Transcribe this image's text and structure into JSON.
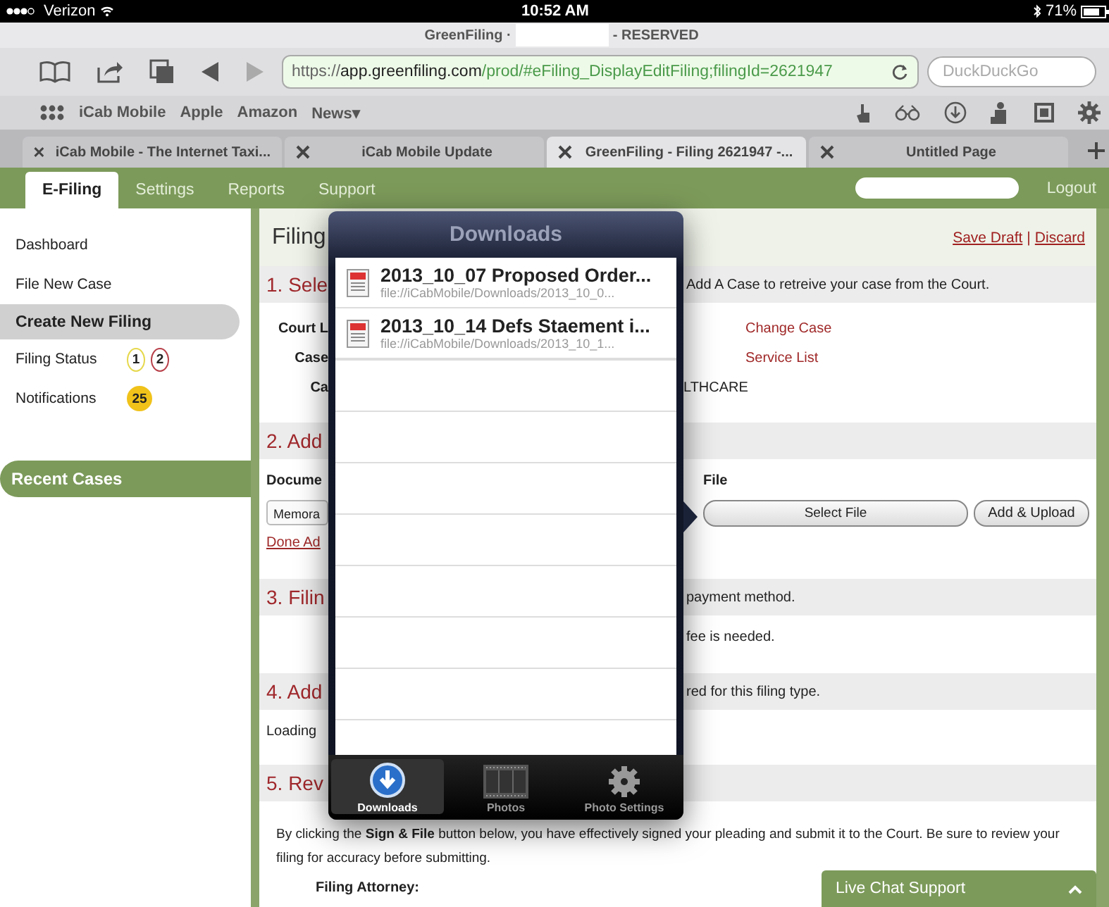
{
  "status_bar": {
    "carrier": "Verizon",
    "time": "10:52 AM",
    "battery": "71%"
  },
  "title_bar": {
    "left": "GreenFiling ·",
    "right": "- RESERVED"
  },
  "toolbar": {
    "url_scheme": "https://",
    "url_host": "app.greenfiling.com",
    "url_path": "/prod/#eFiling_DisplayEditFiling;filingId=2621947",
    "search_placeholder": "DuckDuckGo"
  },
  "bookmarks": [
    "iCab Mobile",
    "Apple",
    "Amazon",
    "News▾"
  ],
  "browser_tabs": [
    {
      "label": "iCab Mobile - The Internet Taxi...",
      "selected": false
    },
    {
      "label": "iCab Mobile Update",
      "selected": false
    },
    {
      "label": "GreenFiling - Filing 2621947 -...",
      "selected": true
    },
    {
      "label": "Untitled Page",
      "selected": false
    }
  ],
  "nav": {
    "tabs": [
      {
        "label": "E-Filing",
        "selected": true
      },
      {
        "label": "Settings",
        "selected": false
      },
      {
        "label": "Reports",
        "selected": false
      },
      {
        "label": "Support",
        "selected": false
      }
    ],
    "logout": "Logout"
  },
  "sidebar": {
    "items": [
      {
        "label": "Dashboard",
        "selected": false
      },
      {
        "label": "File New Case",
        "selected": false
      },
      {
        "label": "Create New Filing",
        "selected": true
      },
      {
        "label": "Filing Status",
        "selected": false,
        "badges": [
          {
            "text": "1",
            "kind": "outline",
            "color": "#e6d84c"
          },
          {
            "text": "2",
            "kind": "outline",
            "color": "#b8404a"
          }
        ]
      },
      {
        "label": "Notifications",
        "selected": false,
        "badges": [
          {
            "text": "25",
            "kind": "filled",
            "color": "#f0c21a"
          }
        ]
      }
    ],
    "recent": "Recent Cases"
  },
  "main": {
    "title": "Filing",
    "actions": [
      "Save Draft",
      "Discard"
    ],
    "separator": "|",
    "rows": [
      {
        "kind": "header",
        "left": "1. Sele",
        "right": "Add A Case to retreive your case from the Court."
      },
      {
        "kind": "field",
        "left": "Court L",
        "right": "Change Case",
        "link": true
      },
      {
        "kind": "field",
        "left": "Case",
        "right": "Service List",
        "link": true
      },
      {
        "kind": "field",
        "left": "Ca",
        "right": "LTHCARE",
        "link": false
      },
      {
        "kind": "header",
        "left": "2. Add"
      },
      {
        "kind": "label",
        "left": "Docume",
        "right": "File"
      },
      {
        "kind": "controls",
        "left": "Memora",
        "right": "Select File",
        "button": "Add & Upload"
      },
      {
        "kind": "link",
        "left": "Done Ad"
      },
      {
        "kind": "header",
        "left": "3. Filin",
        "right": "payment method."
      },
      {
        "kind": "text",
        "right": "fee is needed."
      },
      {
        "kind": "header",
        "left": "4. Add",
        "right": "red for this filing type."
      },
      {
        "kind": "text",
        "left": "Loading"
      },
      {
        "kind": "header",
        "left": "5. Rev"
      }
    ],
    "paragraph": "By clicking the **Sign & File** button below, you have effectively signed your pleading and submit it to the Court. Be sure to review your filing for accuracy before submitting.",
    "attorney_label": "Filing Attorney:"
  },
  "chat": {
    "label": "Live Chat Support"
  },
  "downloads": {
    "title": "Downloads",
    "items": [
      {
        "name": "2013_10_07 Proposed Order...",
        "path": "file://iCabMobile/Downloads/2013_10_0..."
      },
      {
        "name": "2013_10_14 Defs Staement i...",
        "path": "file://iCabMobile/Downloads/2013_10_1..."
      }
    ],
    "tabs": [
      {
        "label": "Downloads",
        "selected": true,
        "kind": "download"
      },
      {
        "label": "Photos",
        "selected": false,
        "kind": "film"
      },
      {
        "label": "Photo Settings",
        "selected": false,
        "kind": "gear"
      }
    ]
  }
}
